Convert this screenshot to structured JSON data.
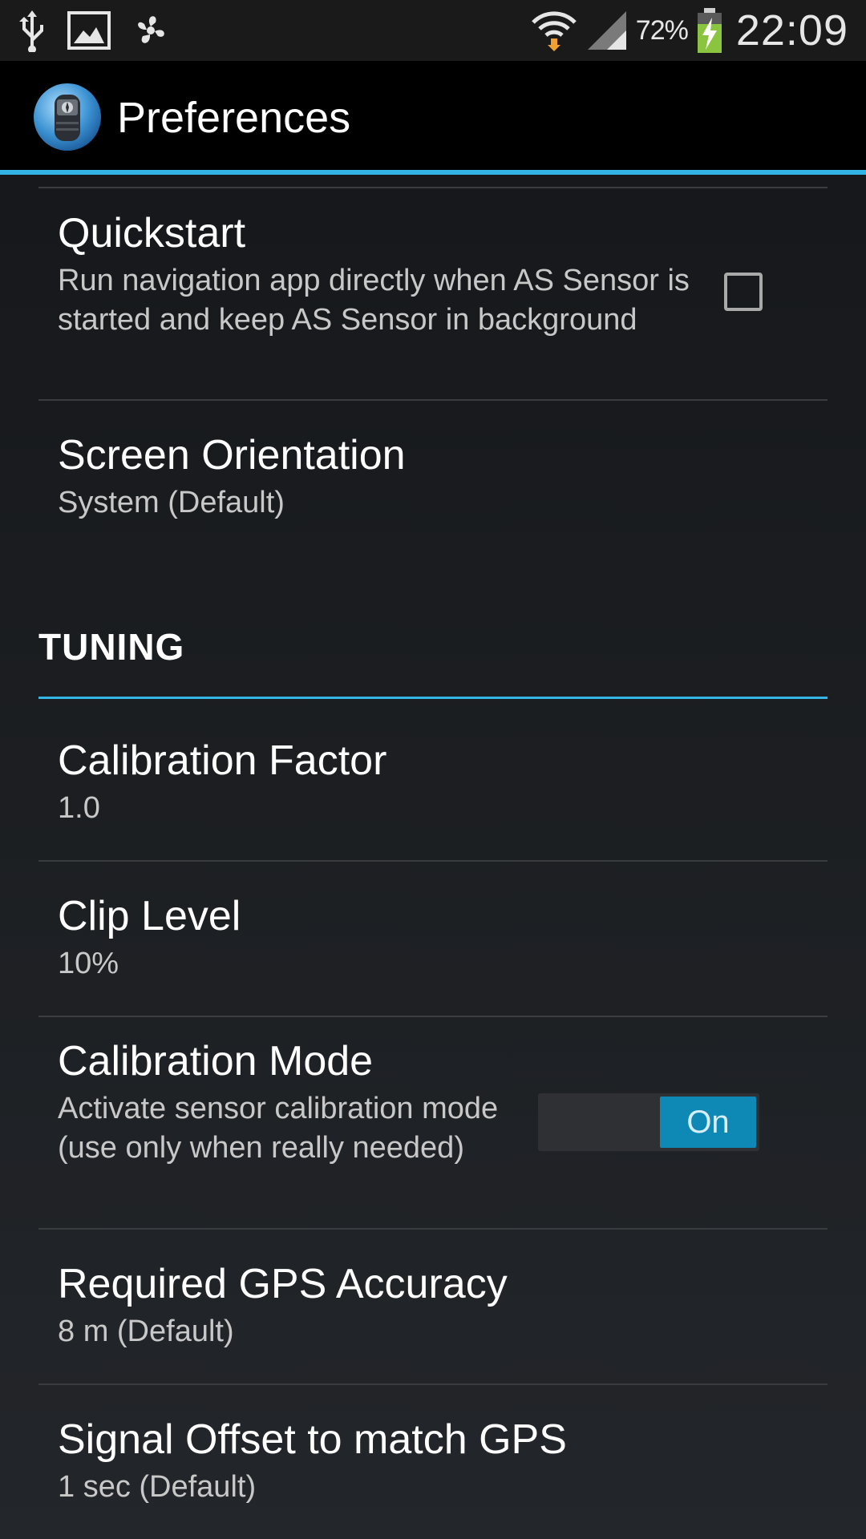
{
  "status_bar": {
    "battery_percent": "72%",
    "time": "22:09",
    "icons": [
      "usb-icon",
      "image-icon",
      "fan-icon",
      "wifi-icon",
      "signal-icon",
      "battery-charging-icon"
    ]
  },
  "action_bar": {
    "title": "Preferences",
    "icon": "anemometer-app-icon"
  },
  "preferences": {
    "quickstart": {
      "title": "Quickstart",
      "summary": "Run navigation app directly when AS Sensor is started and keep AS Sensor in background",
      "checked": false
    },
    "screen_orientation": {
      "title": "Screen Orientation",
      "summary": "System (Default)"
    }
  },
  "tuning": {
    "header": "TUNING",
    "calibration_factor": {
      "title": "Calibration Factor",
      "summary": "1.0"
    },
    "clip_level": {
      "title": "Clip Level",
      "summary": "10%"
    },
    "calibration_mode": {
      "title": "Calibration Mode",
      "summary": "Activate sensor calibration mode (use only when really needed)",
      "toggle_label": "On"
    },
    "gps_accuracy": {
      "title": "Required GPS Accuracy",
      "summary": "8 m (Default)"
    },
    "signal_offset": {
      "title": "Signal Offset to match GPS",
      "summary": "1 sec (Default)"
    }
  },
  "colors": {
    "accent": "#33b5e5",
    "toggle_on": "#0e88b5",
    "background": "#1c1e21",
    "action_bar": "#000000"
  }
}
